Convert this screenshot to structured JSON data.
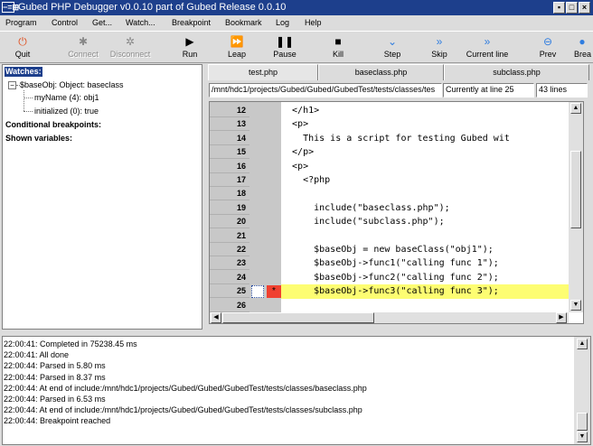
{
  "window": {
    "title": "Gubed PHP Debugger v0.0.10 part of Gubed Release 0.0.10",
    "app_icon": "−=⊞",
    "buttons": {
      "minimize": "▪",
      "maximize": "□",
      "close": "×"
    }
  },
  "menu": [
    "Program",
    "Control",
    "Get...",
    "Watch...",
    "Breakpoint",
    "Bookmark",
    "Log",
    "Help"
  ],
  "toolbar": [
    {
      "label": "Quit",
      "icon": "quit-icon",
      "glyph": "⏻",
      "color": "#e05020",
      "enabled": true
    },
    {
      "label": "Connect",
      "icon": "connect-icon",
      "glyph": "✱",
      "color": "#888888",
      "enabled": false
    },
    {
      "label": "Disconnect",
      "icon": "disconnect-icon",
      "glyph": "✲",
      "color": "#888888",
      "enabled": false
    },
    {
      "label": "Run",
      "icon": "run-icon",
      "glyph": "▶",
      "color": "#000000",
      "enabled": true
    },
    {
      "label": "Leap",
      "icon": "leap-icon",
      "glyph": "⏩",
      "color": "#000000",
      "enabled": true
    },
    {
      "label": "Pause",
      "icon": "pause-icon",
      "glyph": "❚❚",
      "color": "#000000",
      "enabled": true
    },
    {
      "label": "Kill",
      "icon": "kill-icon",
      "glyph": "■",
      "color": "#000000",
      "enabled": true
    },
    {
      "label": "Step",
      "icon": "step-icon",
      "glyph": "⌄",
      "color": "#2f7de0",
      "enabled": true
    },
    {
      "label": "Skip",
      "icon": "skip-icon",
      "glyph": "»",
      "color": "#2f7de0",
      "enabled": true
    },
    {
      "label": "Current line",
      "icon": "current-line-icon",
      "glyph": "»",
      "color": "#2f7de0",
      "enabled": true
    },
    {
      "label": "Prev",
      "icon": "prev-icon",
      "glyph": "⊖",
      "color": "#2f7de0",
      "enabled": true
    },
    {
      "label": "Brea",
      "icon": "breakpoint-icon",
      "glyph": "●",
      "color": "#2f7de0",
      "enabled": true
    }
  ],
  "watches": {
    "header": "Watches:",
    "items": [
      {
        "text": "$baseObj: Object: baseclass",
        "level": 0,
        "expanded": true
      },
      {
        "text": "myName (4): obj1",
        "level": 1
      },
      {
        "text": "initialized (0): true",
        "level": 1
      }
    ],
    "sections": [
      "Conditional breakpoints:",
      "Shown variables:"
    ]
  },
  "tabs": [
    "test.php",
    "baseclass.php",
    "subclass.php"
  ],
  "active_tab": 0,
  "path": "/mnt/hdc1/projects/Gubed/Gubed/GubedTest/tests/classes/tes",
  "current_line_status": "Currently at line 25",
  "lines_count": "43 lines",
  "code": [
    {
      "num": "12",
      "text": "  </h1>"
    },
    {
      "num": "13",
      "text": "  <p>"
    },
    {
      "num": "14",
      "text": "    This is a script for testing Gubed wit"
    },
    {
      "num": "15",
      "text": "  </p>"
    },
    {
      "num": "16",
      "text": "  <p>"
    },
    {
      "num": "17",
      "text": "    <?php"
    },
    {
      "num": "18",
      "text": ""
    },
    {
      "num": "19",
      "text": "      include(\"baseclass.php\");"
    },
    {
      "num": "20",
      "text": "      include(\"subclass.php\");"
    },
    {
      "num": "21",
      "text": ""
    },
    {
      "num": "22",
      "text": "      $baseObj = new baseClass(\"obj1\");"
    },
    {
      "num": "23",
      "text": "      $baseObj->func1(\"calling func 1\");"
    },
    {
      "num": "24",
      "text": "      $baseObj->func2(\"calling func 2\");"
    },
    {
      "num": "25",
      "text": "      $baseObj->func3(\"calling func 3\");",
      "current": true,
      "breakpoint": "*"
    },
    {
      "num": "26",
      "text": ""
    }
  ],
  "log": [
    "22:00:41: Completed in 75238.45 ms",
    "22:00:41: All done",
    "22:00:44: Parsed in 5.80 ms",
    "22:00:44: Parsed in 8.37 ms",
    "22:00:44: At end of include:/mnt/hdc1/projects/Gubed/Gubed/GubedTest/tests/classes/baseclass.php",
    "22:00:44: Parsed in 6.53 ms",
    "22:00:44: At end of include:/mnt/hdc1/projects/Gubed/Gubed/GubedTest/tests/classes/subclass.php",
    "22:00:44: Breakpoint reached"
  ],
  "colors": {
    "title_bg": "#1d3f8c",
    "highlight": "#fdfd72",
    "breakpoint": "#f04030",
    "gutter": "#c8c8c8"
  }
}
